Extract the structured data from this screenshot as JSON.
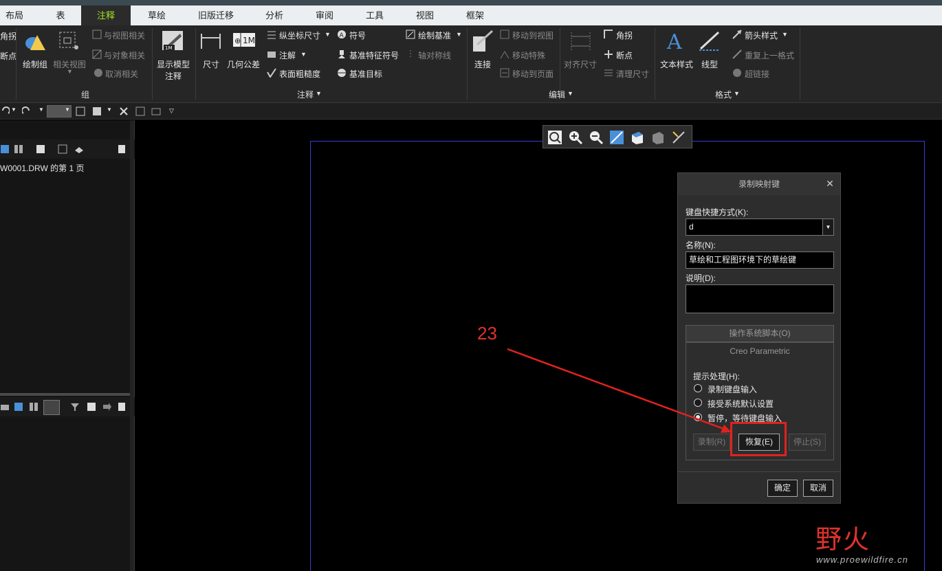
{
  "tabs": [
    {
      "label": "布局",
      "active": false
    },
    {
      "label": "表",
      "active": false
    },
    {
      "label": "注释",
      "active": true
    },
    {
      "label": "草绘",
      "active": false
    },
    {
      "label": "旧版迁移",
      "active": false
    },
    {
      "label": "分析",
      "active": false
    },
    {
      "label": "审阅",
      "active": false
    },
    {
      "label": "工具",
      "active": false
    },
    {
      "label": "视图",
      "active": false
    },
    {
      "label": "框架",
      "active": false
    }
  ],
  "ribbon": {
    "edge_items": [
      "角拐",
      "断点"
    ],
    "group_zu": {
      "draw_group": "绘制组",
      "related_view": "相关视图",
      "relate_to_view": "与视图相关",
      "relate_to_object": "与对象相关",
      "unrelate": "取消相关",
      "label": "组"
    },
    "group_annot": {
      "show_model_annot_1": "显示模型",
      "show_model_annot_2": "注释",
      "dimension": "尺寸",
      "gtol": "几何公差",
      "ordinate_dim": "纵坐标尺寸",
      "note": "注解",
      "surface_finish": "表面粗糙度",
      "symbol": "符号",
      "datum_feature_symbol": "基准特征符号",
      "datum_target": "基准目标",
      "draw_datum": "绘制基准",
      "axis_symmetry": "轴对称线",
      "label": "注释"
    },
    "group_edit": {
      "connect": "连接",
      "move_to_view": "移动到视图",
      "move_special": "移动特殊",
      "move_to_page": "移动到页面",
      "align_dim": "对齐尺寸",
      "corner": "角拐",
      "breakpoint": "断点",
      "clean_dim": "清理尺寸",
      "label": "编辑"
    },
    "group_format": {
      "text_style": "文本样式",
      "line_style": "线型",
      "arrow_style": "箭头样式",
      "repeat_format": "重复上一格式",
      "hyperlink": "超链接",
      "label": "格式"
    }
  },
  "left_panel": {
    "tree_item": "W0001.DRW 的第 1 页"
  },
  "dialog": {
    "title": "录制映射键",
    "shortcut_label": "键盘快捷方式(K):",
    "shortcut_value": "d",
    "name_label": "名称(N):",
    "name_value": "草绘和工程图环境下的草绘键",
    "desc_label": "说明(D):",
    "desc_value": "",
    "os_script": "操作系统脚本(O)",
    "creo": "Creo Parametric",
    "prompt_label": "提示处理(H):",
    "options": [
      {
        "label": "录制键盘输入",
        "checked": false
      },
      {
        "label": "接受系统默认设置",
        "checked": false
      },
      {
        "label": "暂停，等待键盘输入",
        "checked": true
      }
    ],
    "btn_record": "录制(R)",
    "btn_resume": "恢复(E)",
    "btn_stop": "停止(S)",
    "btn_ok": "确定",
    "btn_cancel": "取消"
  },
  "annotation": {
    "number": "23",
    "color": "#e0322b"
  },
  "watermark": {
    "logo": "野火",
    "url": "www.proewildfire.cn"
  },
  "colors": {
    "accent_green": "#9fe21f",
    "sheet_border": "#3b3bd8",
    "highlight_red": "#e0221f"
  }
}
